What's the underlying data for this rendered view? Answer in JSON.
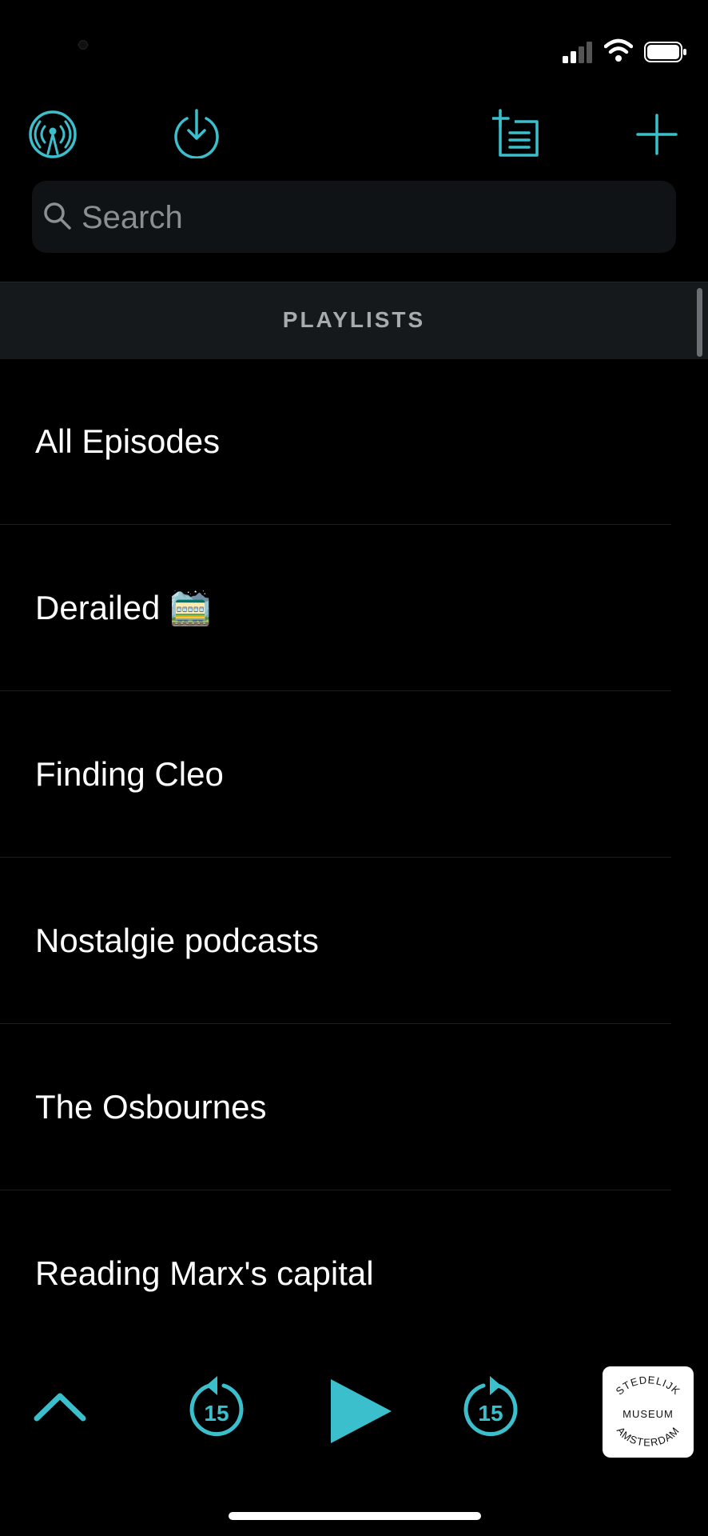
{
  "colors": {
    "accent": "#3bbfcc",
    "background": "#000000",
    "header_bg": "#15191c",
    "search_bg": "#0f1316",
    "placeholder": "#8b8e93"
  },
  "icons": {
    "podcast": "podcast-antenna-icon",
    "download": "download-icon",
    "add_playlist": "add-playlist-icon",
    "add": "plus-icon",
    "search": "search-icon",
    "expand": "chevron-up-icon",
    "skip_back": "skip-back-15-icon",
    "play": "play-icon",
    "skip_forward": "skip-forward-15-icon"
  },
  "search": {
    "placeholder": "Search"
  },
  "section": {
    "title": "PLAYLISTS"
  },
  "playlists": [
    {
      "label": "All Episodes"
    },
    {
      "label": "Derailed 🚞"
    },
    {
      "label": "Finding Cleo"
    },
    {
      "label": "Nostalgie podcasts"
    },
    {
      "label": "The Osbournes"
    },
    {
      "label": "Reading Marx's capital"
    }
  ],
  "player": {
    "skip_back_seconds": "15",
    "skip_forward_seconds": "15",
    "artwork_text": {
      "top": "STEDELIJK",
      "middle": "MUSEUM",
      "bottom": "AMSTERDAM"
    }
  }
}
